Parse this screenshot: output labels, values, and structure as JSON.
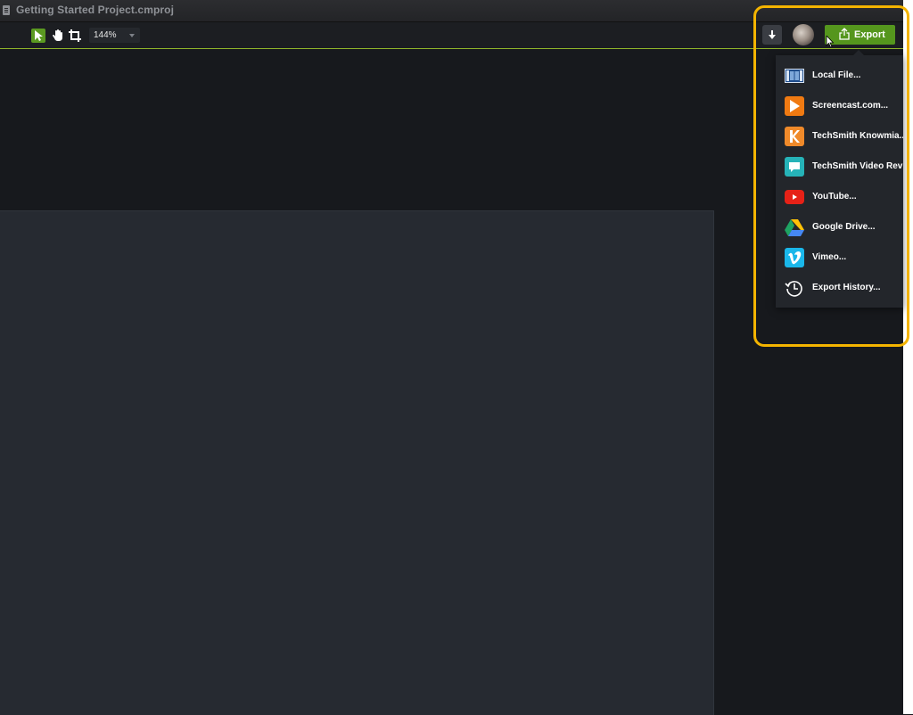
{
  "window": {
    "title": "Getting Started Project.cmproj"
  },
  "toolbar": {
    "zoom_value": "144%",
    "export_label": "Export"
  },
  "export_menu": {
    "items": [
      {
        "label": "Local File...",
        "icon": "film-strip-icon"
      },
      {
        "label": "Screencast.com...",
        "icon": "screencast-icon"
      },
      {
        "label": "TechSmith Knowmia...",
        "icon": "knowmia-icon"
      },
      {
        "label": "TechSmith Video Review",
        "icon": "video-review-icon"
      },
      {
        "label": "YouTube...",
        "icon": "youtube-icon"
      },
      {
        "label": "Google Drive...",
        "icon": "google-drive-icon"
      },
      {
        "label": "Vimeo...",
        "icon": "vimeo-icon"
      },
      {
        "label": "Export History...",
        "icon": "history-icon"
      }
    ]
  },
  "colors": {
    "accent_green": "#55961d",
    "highlight": "#f4b400",
    "background": "#17191d",
    "canvas": "#262a31"
  }
}
